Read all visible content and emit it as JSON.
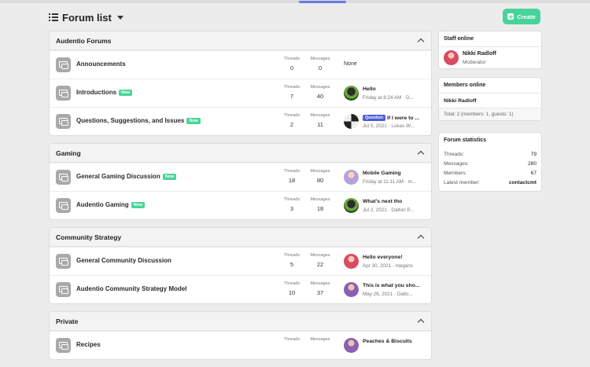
{
  "header": {
    "title": "Forum list",
    "create_label": "Create"
  },
  "categories": [
    {
      "title": "Audentio Forums",
      "nodes": [
        {
          "title": "Announcements",
          "new": false,
          "threads": "0",
          "messages": "0",
          "last": {
            "none": "None"
          }
        },
        {
          "title": "Introductions",
          "new": true,
          "threads": "7",
          "messages": "40",
          "last": {
            "title": "Hello",
            "meta": "Friday at 8:24 AM · D..."
          }
        },
        {
          "title": "Questions, Suggestions, and Issues",
          "new": true,
          "threads": "2",
          "messages": "11",
          "last": {
            "badge": "Question",
            "title": "If I were to ...",
            "meta": "Jul 5, 2021 · Lukas W..."
          }
        }
      ]
    },
    {
      "title": "Gaming",
      "nodes": [
        {
          "title": "General Gaming Discussion",
          "new": true,
          "threads": "18",
          "messages": "80",
          "last": {
            "title": "Mobile Gaming",
            "meta": "Friday at 11:11 AM · m..."
          }
        },
        {
          "title": "Audentio Gaming",
          "new": true,
          "threads": "3",
          "messages": "18",
          "last": {
            "title": "What's next tho",
            "meta": "Jul 2, 2021 · Dalton P..."
          }
        }
      ]
    },
    {
      "title": "Community Strategy",
      "nodes": [
        {
          "title": "General Community Discussion",
          "new": false,
          "threads": "5",
          "messages": "22",
          "last": {
            "title": "Hello everyone!",
            "meta": "Apr 30, 2021 · megans"
          }
        },
        {
          "title": "Audentio Community Strategy Model",
          "new": false,
          "threads": "10",
          "messages": "37",
          "last": {
            "title": "This is what you sho...",
            "meta": "May 26, 2021 · Dalto..."
          }
        }
      ]
    },
    {
      "title": "Private",
      "nodes": [
        {
          "title": "Recipes",
          "new": false,
          "threads": "",
          "messages": "",
          "last": {
            "title": "Peaches & Biscuits",
            "meta": ""
          }
        }
      ]
    }
  ],
  "labels": {
    "threads": "Threads",
    "messages": "Messages",
    "new": "New"
  },
  "sidebar": {
    "staff": {
      "title": "Staff online",
      "name": "Nikki Radloff",
      "role": "Moderator"
    },
    "members": {
      "title": "Members online",
      "list": "Nikki Radloff",
      "total": "Total: 2 (members: 1, guests: 1)"
    },
    "stats": {
      "title": "Forum statistics",
      "rows": [
        {
          "k": "Threads:",
          "v": "79"
        },
        {
          "k": "Messages:",
          "v": "280"
        },
        {
          "k": "Members:",
          "v": "67"
        },
        {
          "k": "Latest member:",
          "v": "contactcmt"
        }
      ]
    }
  },
  "colors": {
    "accent": "#49d39a",
    "question": "#4f5cd8",
    "tab_indicator": "#6c78e6"
  }
}
